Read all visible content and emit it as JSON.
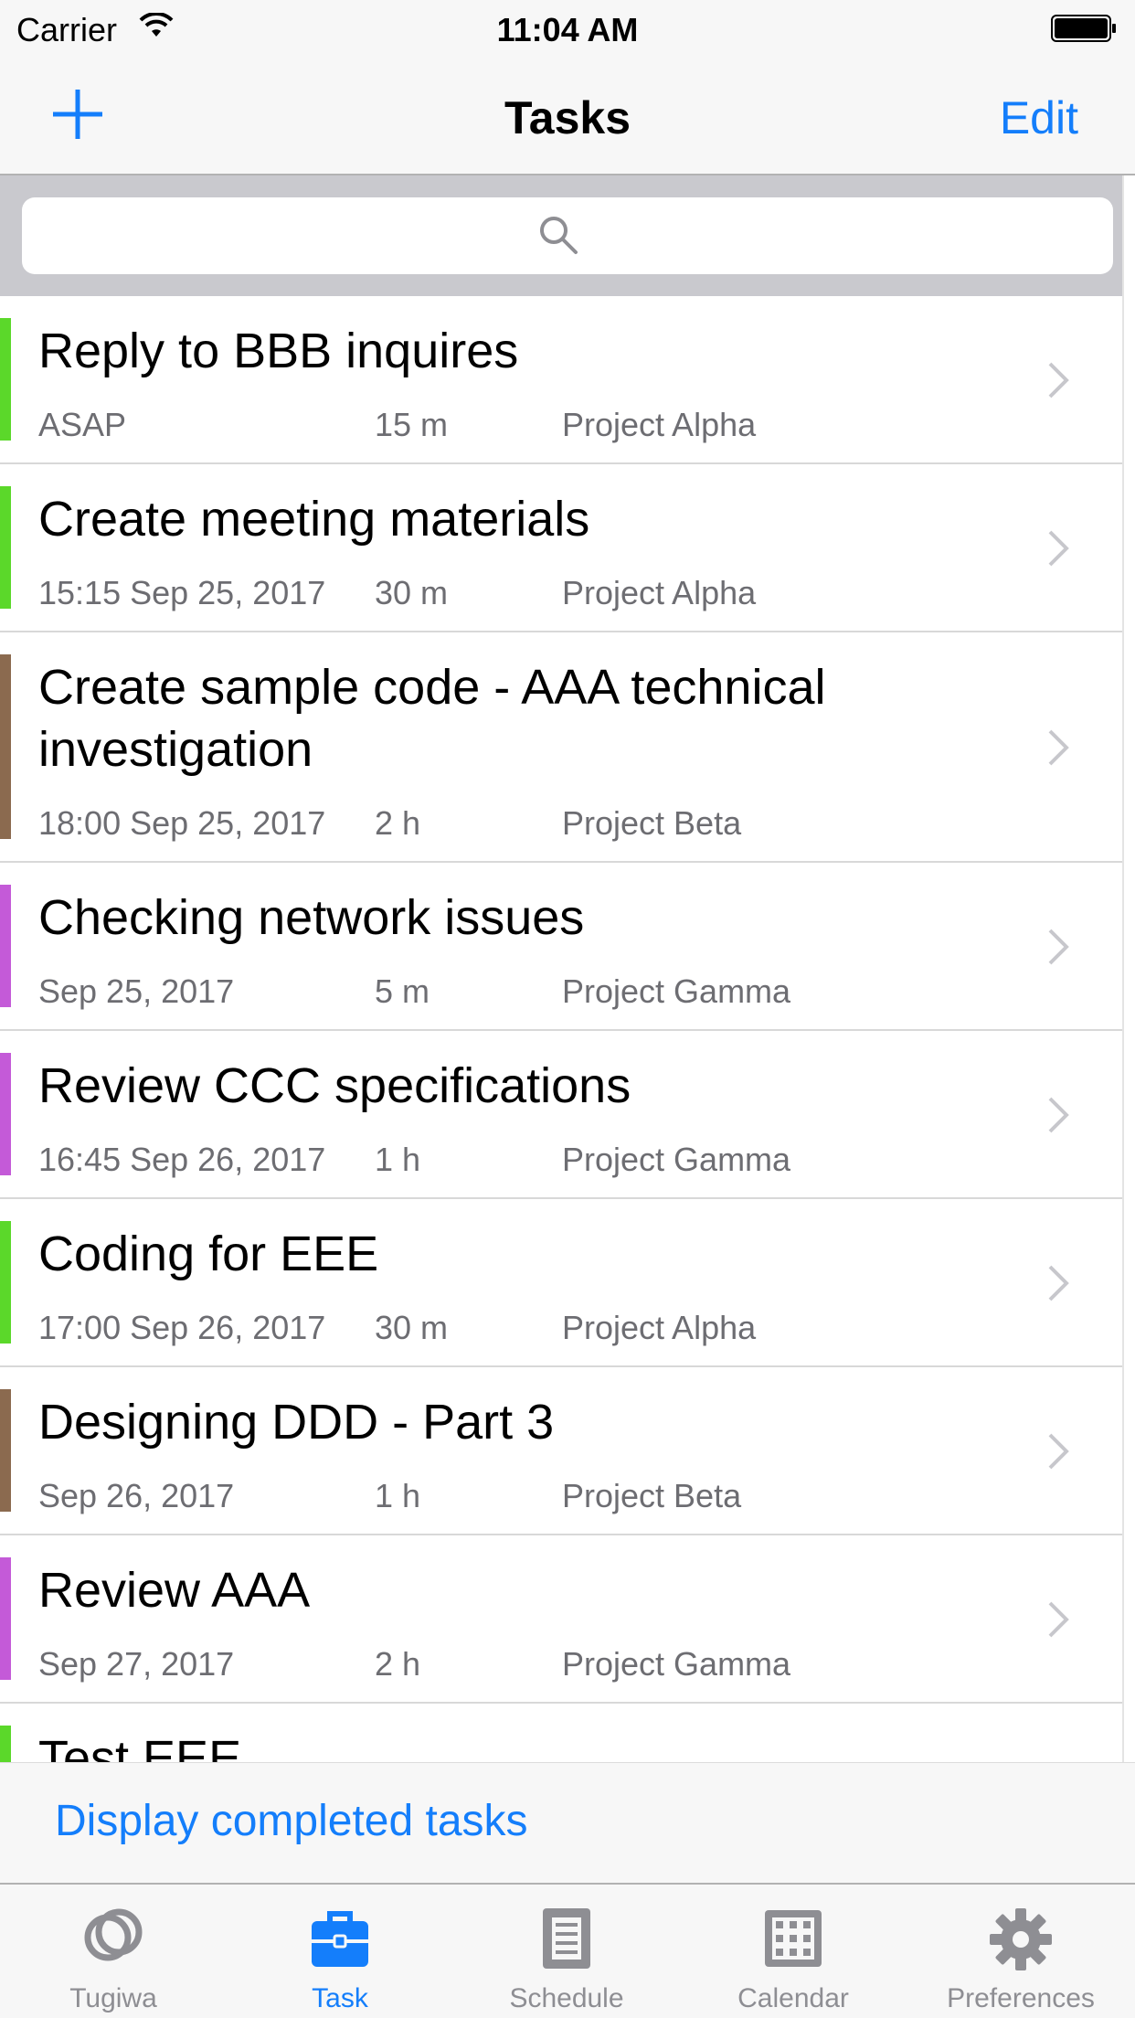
{
  "status_bar": {
    "carrier": "Carrier",
    "time": "11:04 AM"
  },
  "nav": {
    "title": "Tasks",
    "edit_label": "Edit"
  },
  "tasks": [
    {
      "title": "Reply to BBB inquires",
      "date": "ASAP",
      "duration": "15 m",
      "project": "Project Alpha",
      "color": "#5bd82a"
    },
    {
      "title": "Create meeting materials",
      "date": "15:15 Sep 25, 2017",
      "duration": "30 m",
      "project": "Project Alpha",
      "color": "#5bd82a"
    },
    {
      "title": "Create sample code - AAA technical investigation",
      "date": "18:00 Sep 25, 2017",
      "duration": "2 h",
      "project": "Project Beta",
      "color": "#8b6a4f"
    },
    {
      "title": "Checking network issues",
      "date": "Sep 25, 2017",
      "duration": "5 m",
      "project": "Project Gamma",
      "color": "#c45ad8"
    },
    {
      "title": "Review CCC specifications",
      "date": "16:45 Sep 26, 2017",
      "duration": "1 h",
      "project": "Project Gamma",
      "color": "#c45ad8"
    },
    {
      "title": "Coding for EEE",
      "date": "17:00 Sep 26, 2017",
      "duration": "30 m",
      "project": "Project Alpha",
      "color": "#5bd82a"
    },
    {
      "title": "Designing DDD - Part 3",
      "date": "Sep 26, 2017",
      "duration": "1 h",
      "project": "Project Beta",
      "color": "#8b6a4f"
    },
    {
      "title": "Review AAA",
      "date": "Sep 27, 2017",
      "duration": "2 h",
      "project": "Project Gamma",
      "color": "#c45ad8"
    },
    {
      "title": "Test EEE",
      "date": "",
      "duration": "",
      "project": "",
      "color": "#5bd82a"
    }
  ],
  "completed": {
    "label": "Display completed tasks"
  },
  "tabs": [
    {
      "label": "Tugiwa",
      "icon": "rings-icon",
      "active": false
    },
    {
      "label": "Task",
      "icon": "briefcase-icon",
      "active": true
    },
    {
      "label": "Schedule",
      "icon": "document-icon",
      "active": false
    },
    {
      "label": "Calendar",
      "icon": "calendar-icon",
      "active": false
    },
    {
      "label": "Preferences",
      "icon": "gear-icon",
      "active": false
    }
  ],
  "colors": {
    "accent": "#147efb",
    "inactive": "#8e8e93"
  }
}
